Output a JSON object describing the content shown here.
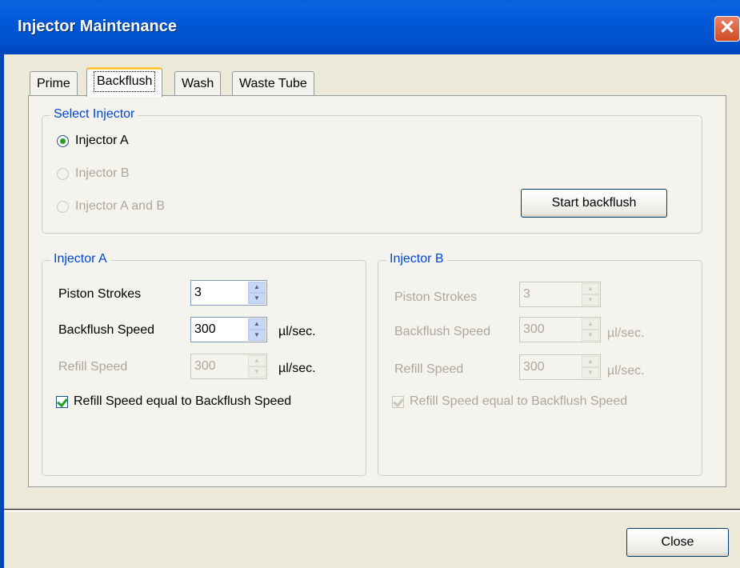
{
  "window": {
    "title": "Injector Maintenance",
    "close_glyph": "✕"
  },
  "tabs": [
    {
      "label": "Prime",
      "active": false
    },
    {
      "label": "Backflush",
      "active": true
    },
    {
      "label": "Wash",
      "active": false
    },
    {
      "label": "Waste Tube",
      "active": false
    }
  ],
  "select_injector": {
    "legend": "Select Injector",
    "options": [
      {
        "label": "Injector A",
        "checked": true,
        "enabled": true
      },
      {
        "label": "Injector B",
        "checked": false,
        "enabled": false
      },
      {
        "label": "Injector A and B",
        "checked": false,
        "enabled": false
      }
    ],
    "start_button": "Start backflush"
  },
  "injector_a": {
    "legend": "Injector A",
    "piston_strokes_label": "Piston Strokes",
    "piston_strokes_value": "3",
    "backflush_speed_label": "Backflush Speed",
    "backflush_speed_value": "300",
    "backflush_unit": "µl/sec.",
    "refill_speed_label": "Refill Speed",
    "refill_speed_value": "300",
    "refill_unit": "µl/sec.",
    "equal_checkbox_label": "Refill Speed equal to Backflush Speed",
    "equal_checked": true
  },
  "injector_b": {
    "legend": "Injector B",
    "piston_strokes_label": "Piston Strokes",
    "piston_strokes_value": "3",
    "backflush_speed_label": "Backflush Speed",
    "backflush_speed_value": "300",
    "backflush_unit": "µl/sec.",
    "refill_speed_label": "Refill Speed",
    "refill_speed_value": "300",
    "refill_unit": "µl/sec.",
    "equal_checkbox_label": "Refill Speed equal to Backflush Speed",
    "equal_checked": true
  },
  "footer": {
    "close_button": "Close"
  },
  "colors": {
    "titlebar": "#0054e3",
    "legend_text": "#0046d5",
    "disabled_text": "#aca899",
    "radio_dot": "#21a121",
    "tab_highlight": "#ffc83c"
  }
}
